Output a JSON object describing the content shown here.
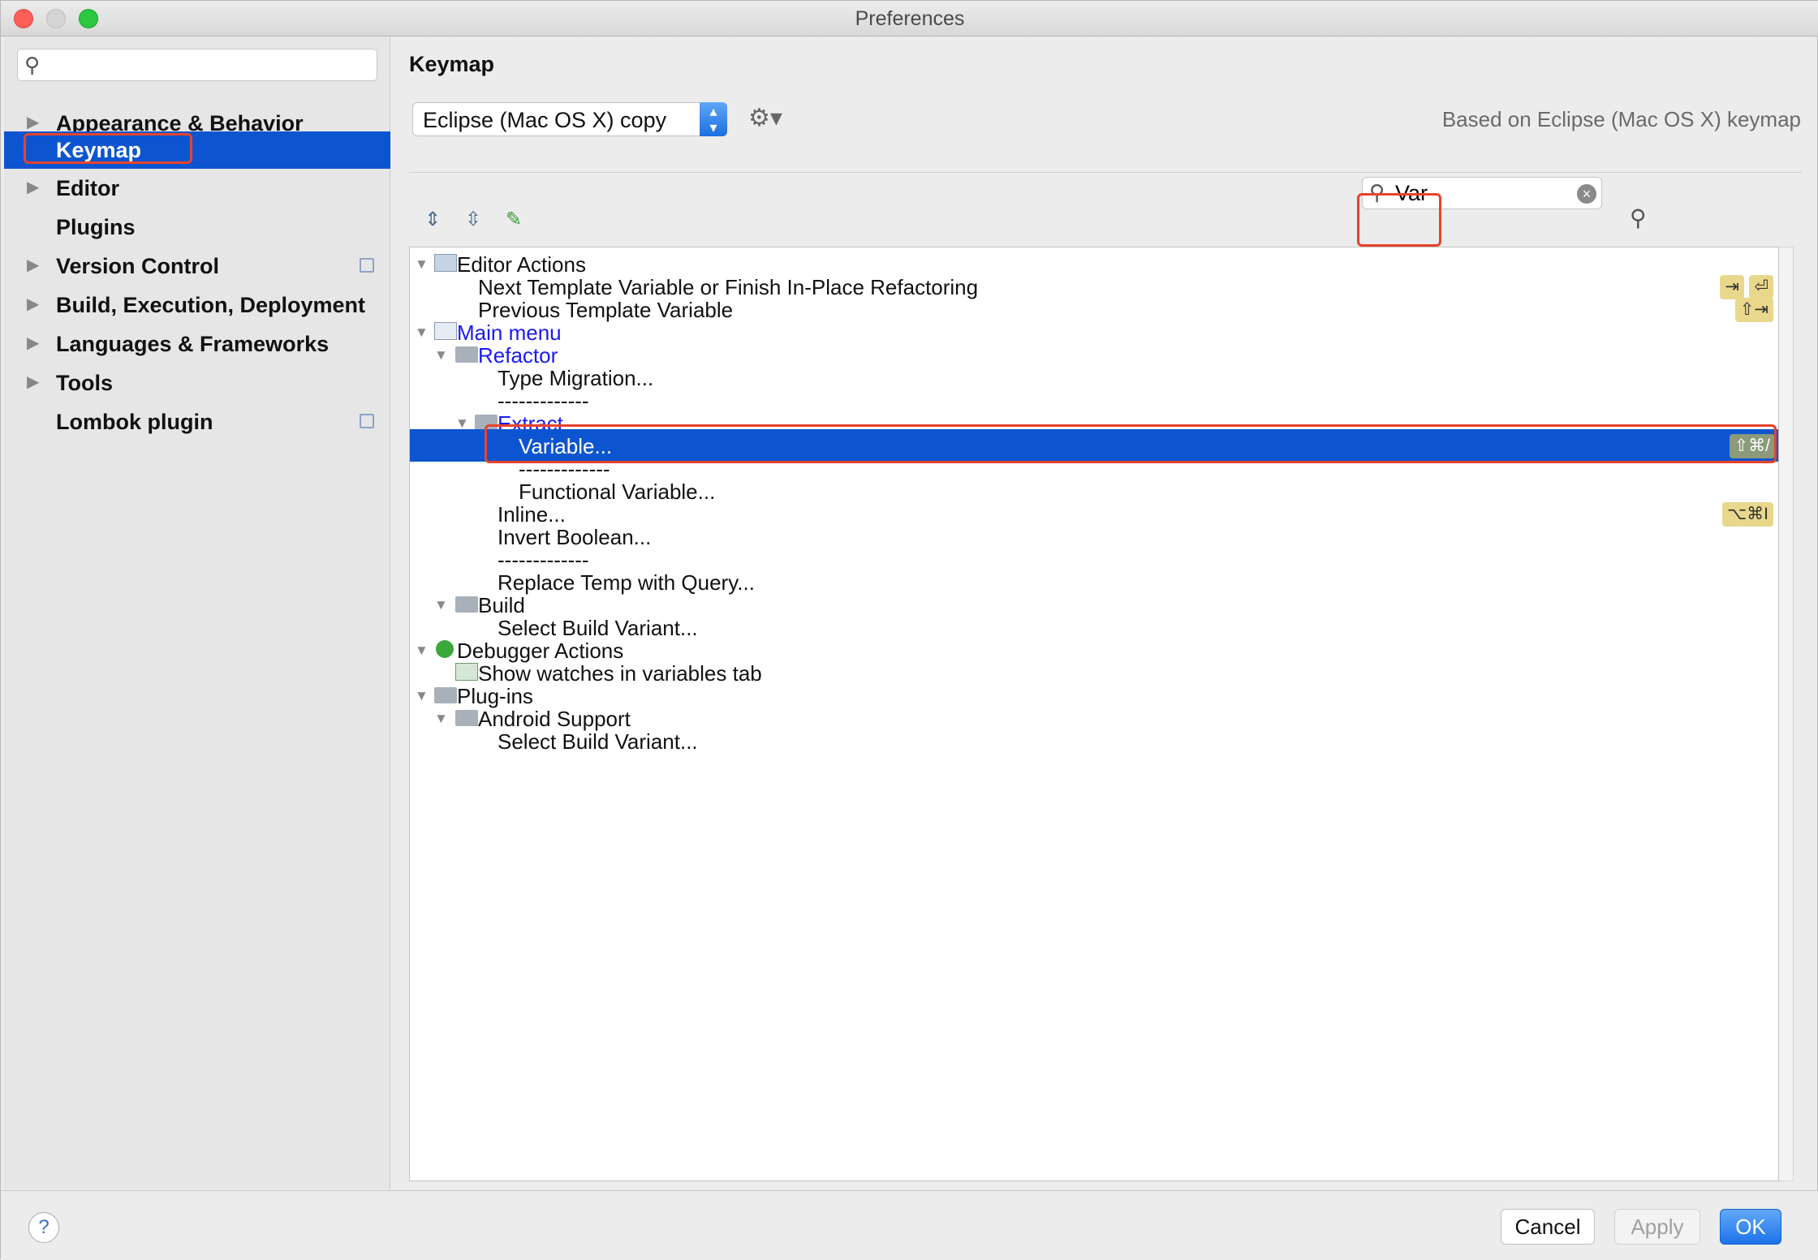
{
  "window": {
    "title": "Preferences"
  },
  "sidebar": {
    "search_placeholder": "",
    "items": [
      {
        "label": "Appearance & Behavior",
        "expandable": true
      },
      {
        "label": "Keymap",
        "selected": true
      },
      {
        "label": "Editor",
        "expandable": true
      },
      {
        "label": "Plugins"
      },
      {
        "label": "Version Control",
        "expandable": true,
        "project_icon": true
      },
      {
        "label": "Build, Execution, Deployment",
        "expandable": true
      },
      {
        "label": "Languages & Frameworks",
        "expandable": true
      },
      {
        "label": "Tools",
        "expandable": true
      },
      {
        "label": "Lombok plugin",
        "project_icon": true
      }
    ]
  },
  "main": {
    "title": "Keymap",
    "keymap_select": "Eclipse (Mac OS X) copy",
    "based_on": "Based on Eclipse (Mac OS X) keymap",
    "filter_value": "Var"
  },
  "tree": {
    "rows": [
      {
        "text": "Editor Actions"
      },
      {
        "text": "Next Template Variable or Finish In-Place Refactoring",
        "shortcuts": [
          "⇥",
          "⏎"
        ]
      },
      {
        "text": "Previous Template Variable",
        "shortcuts": [
          "⇧⇥"
        ]
      },
      {
        "text": "Main menu"
      },
      {
        "text": "Refactor"
      },
      {
        "text": "Type Migration..."
      },
      {
        "text": "-------------"
      },
      {
        "text": "Extract"
      },
      {
        "text": "Variable...",
        "shortcuts": [
          "⇧⌘/"
        ],
        "selected": true
      },
      {
        "text": "-------------"
      },
      {
        "text": "Functional Variable..."
      },
      {
        "text": "Inline...",
        "shortcuts": [
          "⌥⌘I"
        ]
      },
      {
        "text": "Invert Boolean..."
      },
      {
        "text": "-------------"
      },
      {
        "text": "Replace Temp with Query..."
      },
      {
        "text": "Build"
      },
      {
        "text": "Select Build Variant..."
      },
      {
        "text": "Debugger Actions"
      },
      {
        "text": "Show watches in variables tab"
      },
      {
        "text": "Plug-ins"
      },
      {
        "text": "Android Support"
      },
      {
        "text": "Select Build Variant..."
      }
    ]
  },
  "footer": {
    "help": "?",
    "cancel": "Cancel",
    "apply": "Apply",
    "ok": "OK"
  },
  "colors": {
    "selection": "#0d55d0",
    "highlight_box": "#e8432a",
    "shortcut_bg": "#e9d88c",
    "link_blue": "#1a1aee"
  }
}
